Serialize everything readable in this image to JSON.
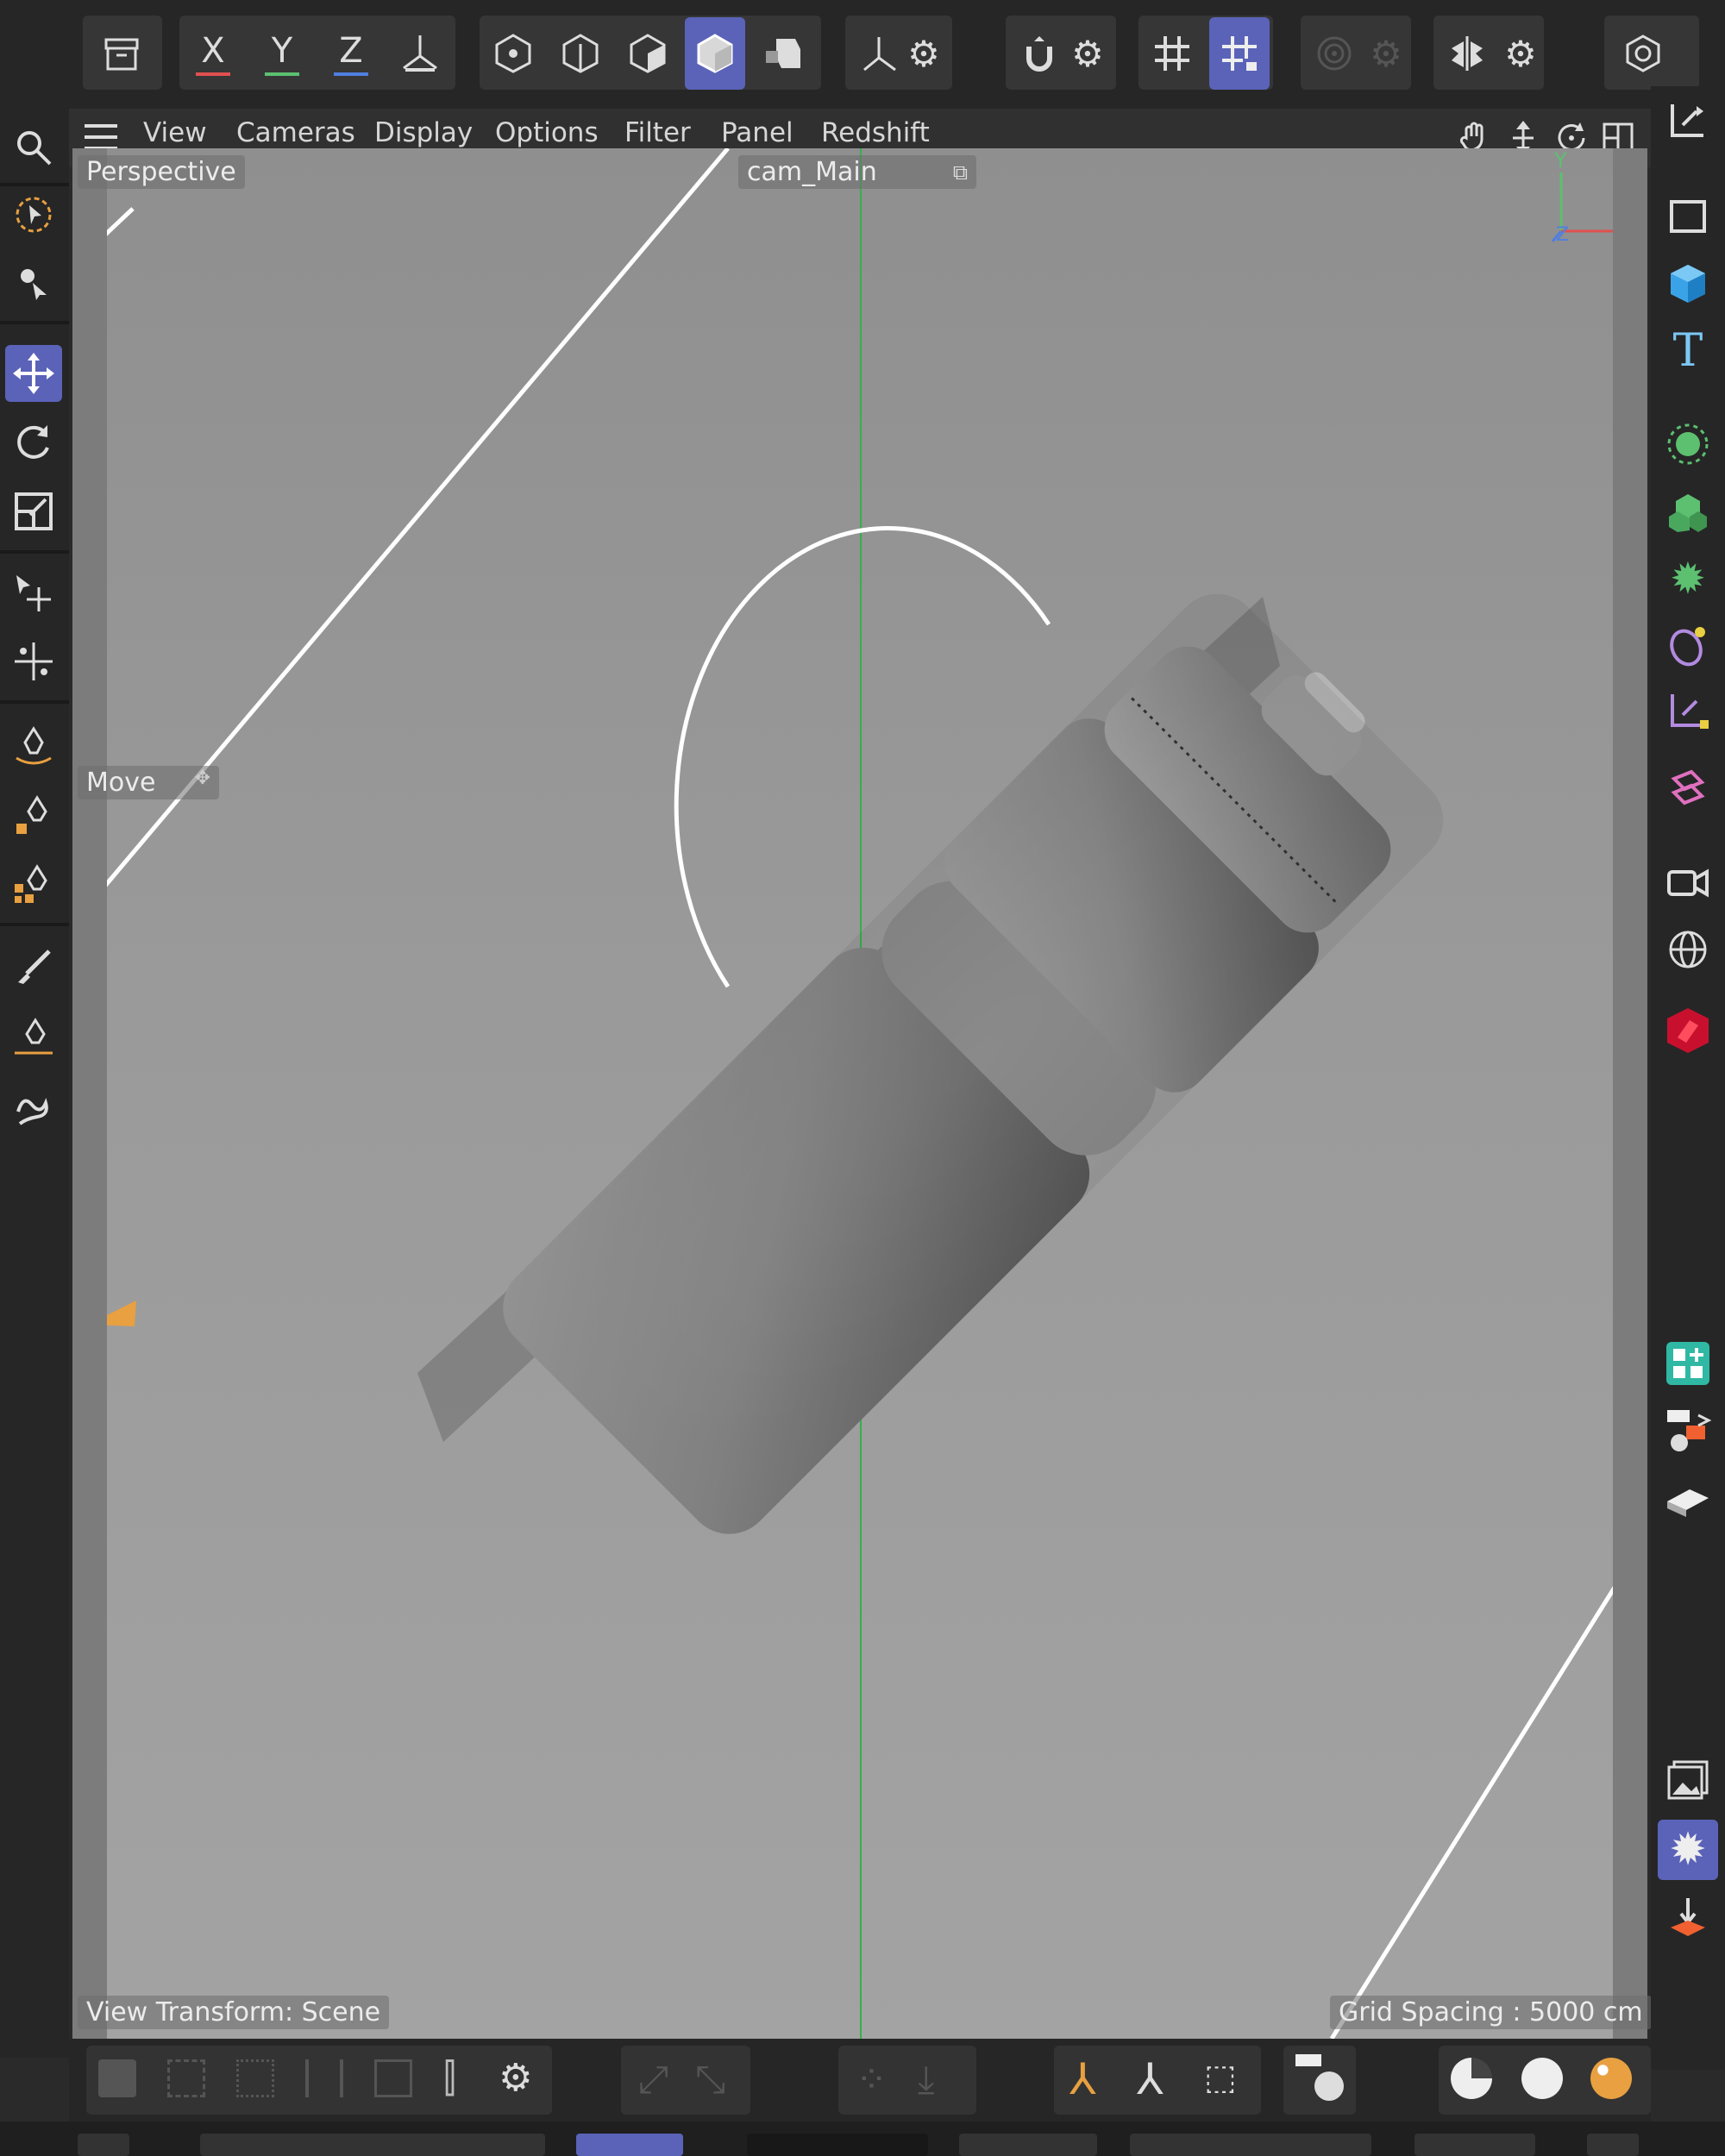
{
  "toolbar": {
    "axis_x": "X",
    "axis_y": "Y",
    "axis_z": "Z",
    "icons": [
      "undo-history-icon",
      "axis-x-lock",
      "axis-y-lock",
      "axis-z-lock",
      "coordinate-system-icon",
      "points-mode-icon",
      "edges-mode-icon",
      "polygons-mode-icon",
      "model-mode-icon",
      "texture-mode-icon",
      "axis-mode-icon",
      "snap-settings-icon",
      "magnet-snap-icon",
      "gear-icon",
      "grid-snap-icon",
      "workplane-snap-icon",
      "render-region-icon",
      "symmetry-icon",
      "view-settings-icon"
    ]
  },
  "menu": {
    "items": [
      "View",
      "Cameras",
      "Display",
      "Options",
      "Filter",
      "Panel",
      "Redshift"
    ]
  },
  "viewport": {
    "view_name": "Perspective",
    "camera_name": "cam_Main",
    "tool_label": "Move",
    "view_transform": "View Transform: Scene",
    "grid_spacing": "Grid Spacing : 5000 cm",
    "axis_labels": {
      "y": "Y",
      "x": "X",
      "z": "Z"
    }
  },
  "left_toolbar": {
    "icons": [
      "search-icon",
      "live-selection-icon",
      "tweak-tool-icon",
      "move-tool-icon",
      "rotate-tool-icon",
      "scale-tool-icon",
      "transfer-tool-icon",
      "multi-move-icon",
      "pen-tool-icon",
      "spline-pen-icon",
      "spline-sketch-icon",
      "brush-tool-icon",
      "spline-draw-icon",
      "spline-smooth-icon"
    ],
    "active": "move-tool-icon"
  },
  "right_toolbar": {
    "icons": [
      "coordinates-mode-icon",
      "rectangle-spline-icon",
      "cube-icon",
      "text-icon",
      "cloner-icon",
      "subdivision-icon",
      "field-icon",
      "deformer-icon",
      "null-object-icon",
      "mograph-icon",
      "camera-icon",
      "environment-icon",
      "redshift-icon",
      "material-manager-icon",
      "render-settings-icon",
      "plane-icon",
      "picture-viewer-icon",
      "render-gear-icon",
      "render-download-icon"
    ],
    "active": "render-gear-icon"
  },
  "colors": {
    "active": "#5a63b8",
    "axis_x": "#e05050",
    "axis_y": "#5cc070",
    "axis_z": "#4f7fe0",
    "accent_orange": "#e8a040"
  }
}
